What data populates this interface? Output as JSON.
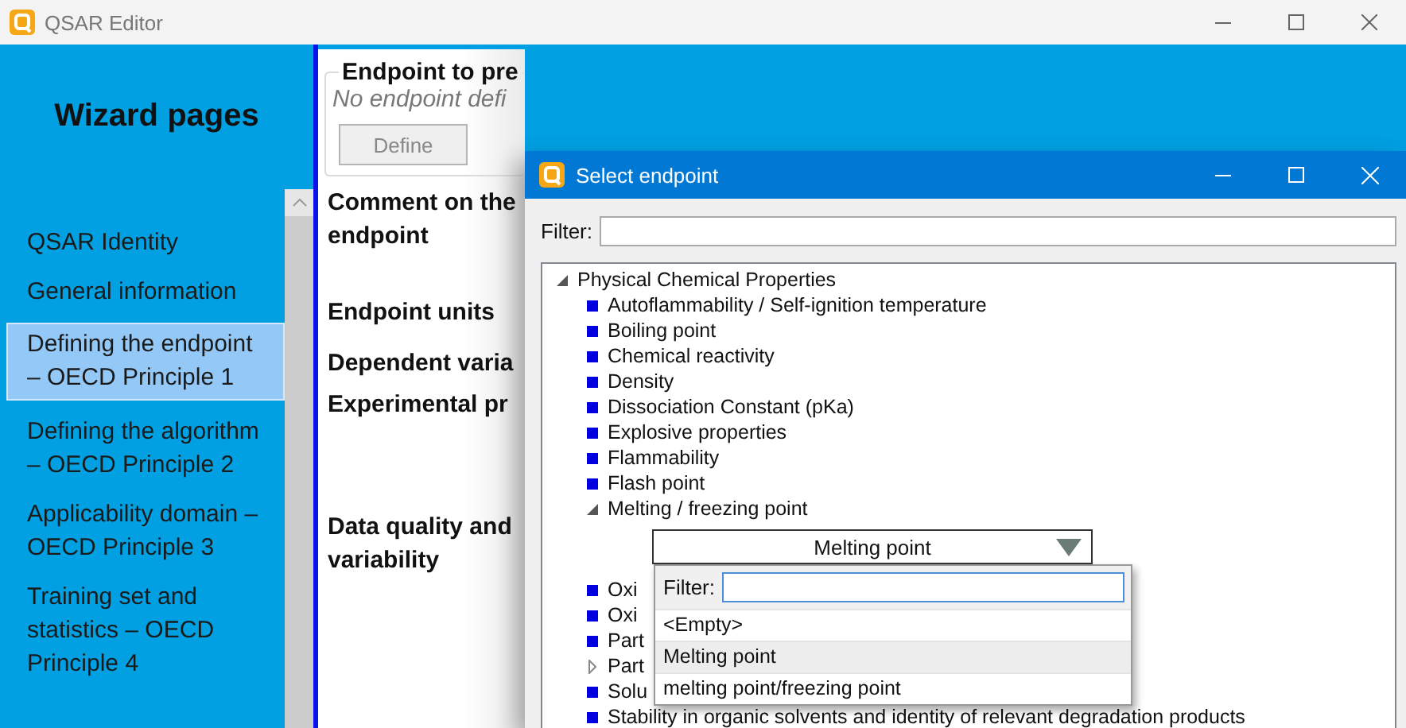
{
  "window": {
    "title": "QSAR Editor"
  },
  "sidebar": {
    "title": "Wizard pages",
    "items": [
      {
        "label": "QSAR Identity",
        "selected": false
      },
      {
        "label": "General information",
        "selected": false
      },
      {
        "label": "Defining the endpoint – OECD Principle 1",
        "selected": true
      },
      {
        "label": "Defining the algorithm – OECD Principle 2",
        "selected": false
      },
      {
        "label": "Applicability domain – OECD Principle 3",
        "selected": false
      },
      {
        "label": "Training set and statistics – OECD Principle 4",
        "selected": false
      }
    ]
  },
  "endpoint_group": {
    "title": "Endpoint to pre",
    "status": "No endpoint defi",
    "button": {
      "label": "Define",
      "disabled": true
    }
  },
  "fields": [
    "Comment on the endpoint",
    "Endpoint units",
    "Dependent varia",
    "Experimental pr",
    "Data quality and variability"
  ],
  "dialog": {
    "title": "Select endpoint",
    "filter_label": "Filter:",
    "tree": {
      "label": "Physical Chemical Properties",
      "kind": "group",
      "expanded": true,
      "children": [
        {
          "label": "Autoflammability / Self-ignition temperature",
          "kind": "leaf"
        },
        {
          "label": "Boiling point",
          "kind": "leaf"
        },
        {
          "label": "Chemical reactivity",
          "kind": "leaf"
        },
        {
          "label": "Density",
          "kind": "leaf"
        },
        {
          "label": "Dissociation Constant (pKa)",
          "kind": "leaf"
        },
        {
          "label": "Explosive properties",
          "kind": "leaf"
        },
        {
          "label": "Flammability",
          "kind": "leaf"
        },
        {
          "label": "Flash point",
          "kind": "leaf"
        },
        {
          "label": "Melting / freezing point",
          "kind": "group",
          "expanded": true,
          "selector": {
            "value": "Melting point",
            "open": true,
            "filter_label": "Filter:",
            "options": [
              {
                "label": "<Empty>",
                "selected": false
              },
              {
                "label": "Melting point",
                "selected": true
              },
              {
                "label": "melting point/freezing point",
                "selected": false
              }
            ]
          }
        },
        {
          "label": "Oxi",
          "kind": "leaf"
        },
        {
          "label": "Oxi",
          "kind": "leaf"
        },
        {
          "label": "Part",
          "kind": "leaf"
        },
        {
          "label": "Part",
          "kind": "group",
          "expanded": false
        },
        {
          "label": "Solu",
          "kind": "leaf"
        },
        {
          "label": "Stability in organic solvents and identity of relevant degradation products",
          "kind": "leaf"
        }
      ]
    }
  }
}
